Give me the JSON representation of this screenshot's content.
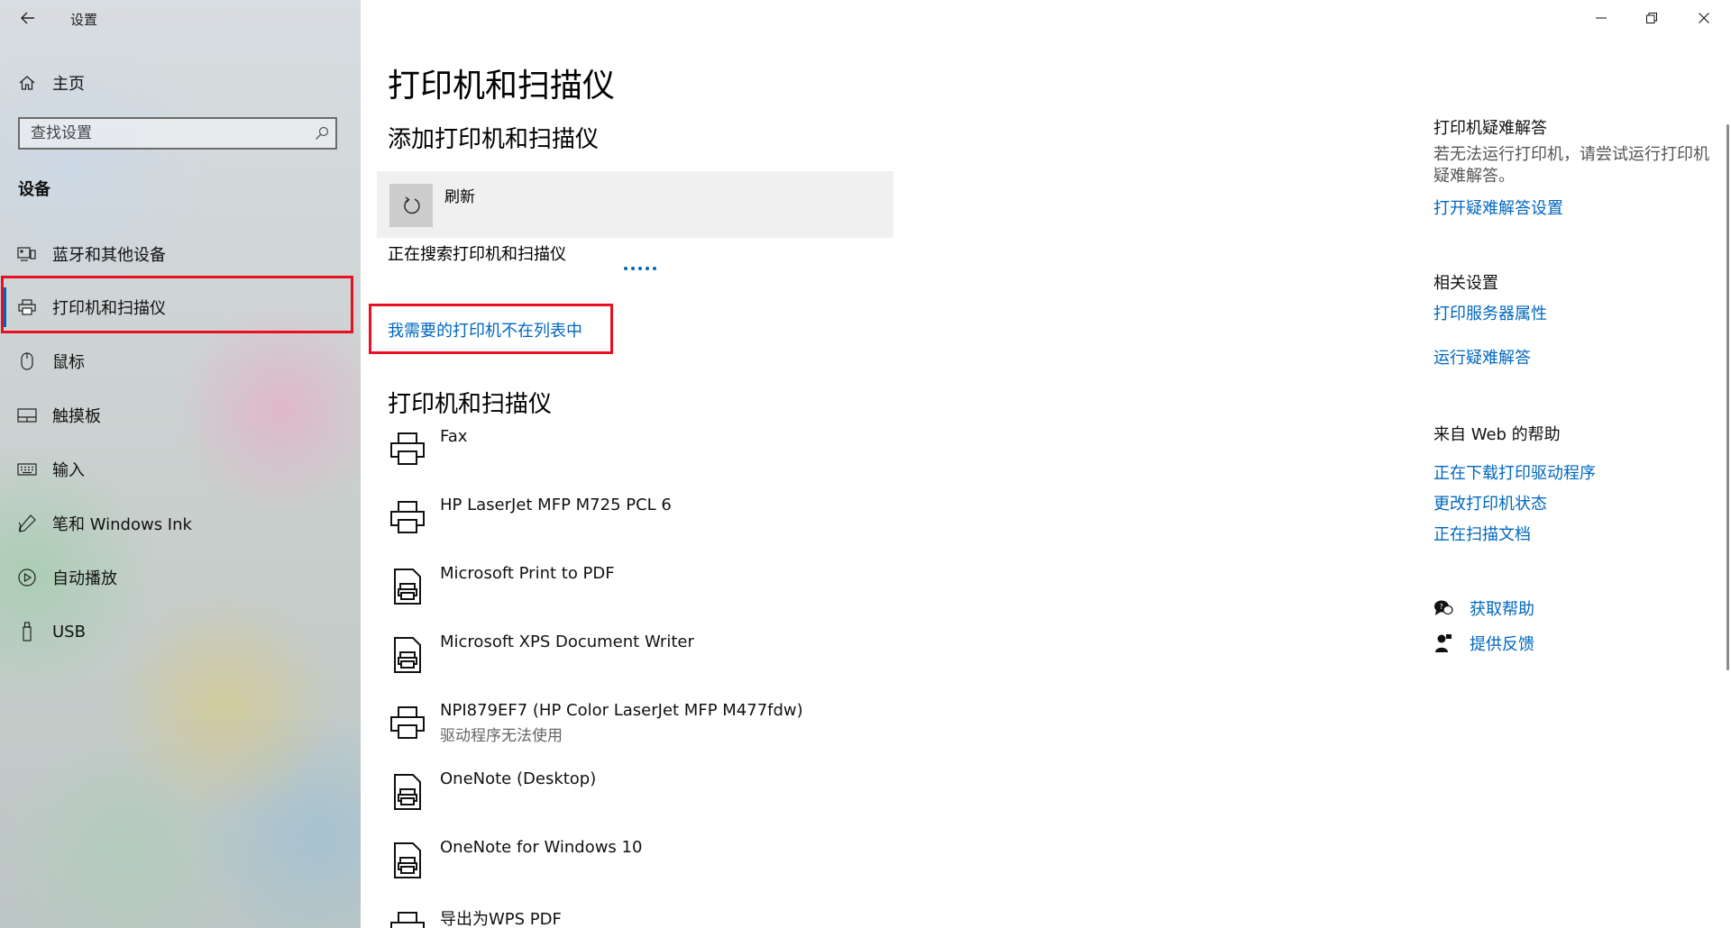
{
  "window": {
    "app_title": "设置",
    "controls": [
      "minimize",
      "maximize",
      "close"
    ]
  },
  "sidebar": {
    "home_label": "主页",
    "search_placeholder": "查找设置",
    "section_heading": "设备",
    "items": [
      {
        "label": "蓝牙和其他设备",
        "icon": "bluetooth-devices-icon"
      },
      {
        "label": "打印机和扫描仪",
        "icon": "printer-icon",
        "selected": true
      },
      {
        "label": "鼠标",
        "icon": "mouse-icon"
      },
      {
        "label": "触摸板",
        "icon": "touchpad-icon"
      },
      {
        "label": "输入",
        "icon": "keyboard-icon"
      },
      {
        "label": "笔和 Windows Ink",
        "icon": "pen-icon"
      },
      {
        "label": "自动播放",
        "icon": "autoplay-icon"
      },
      {
        "label": "USB",
        "icon": "usb-icon"
      }
    ]
  },
  "main": {
    "title": "打印机和扫描仪",
    "add_section_title": "添加打印机和扫描仪",
    "refresh_label": "刷新",
    "searching_text": "正在搜索打印机和扫描仪",
    "missing_printer_link": "我需要的打印机不在列表中",
    "list_title": "打印机和扫描仪",
    "devices": [
      {
        "name": "Fax",
        "type": "printer",
        "status": ""
      },
      {
        "name": "HP LaserJet MFP M725 PCL 6",
        "type": "printer",
        "status": ""
      },
      {
        "name": "Microsoft Print to PDF",
        "type": "document-printer",
        "status": ""
      },
      {
        "name": "Microsoft XPS Document Writer",
        "type": "document-printer",
        "status": ""
      },
      {
        "name": "NPI879EF7 (HP Color LaserJet MFP M477fdw)",
        "type": "printer",
        "status": "驱动程序无法使用"
      },
      {
        "name": "OneNote (Desktop)",
        "type": "document-printer",
        "status": ""
      },
      {
        "name": "OneNote for Windows 10",
        "type": "document-printer",
        "status": ""
      },
      {
        "name": "导出为WPS PDF",
        "type": "printer",
        "status": ""
      }
    ]
  },
  "right_panel": {
    "troubleshoot_heading": "打印机疑难解答",
    "troubleshoot_text": "若无法运行打印机，请尝试运行打印机疑难解答。",
    "troubleshoot_link": "打开疑难解答设置",
    "related_heading": "相关设置",
    "related_links": [
      "打印服务器属性",
      "运行疑难解答"
    ],
    "web_help_heading": "来自 Web 的帮助",
    "web_links": [
      "正在下载打印驱动程序",
      "更改打印机状态",
      "正在扫描文档"
    ],
    "get_help": "获取帮助",
    "give_feedback": "提供反馈"
  },
  "colors": {
    "accent": "#0067c0",
    "highlight_box": "#e81123"
  }
}
